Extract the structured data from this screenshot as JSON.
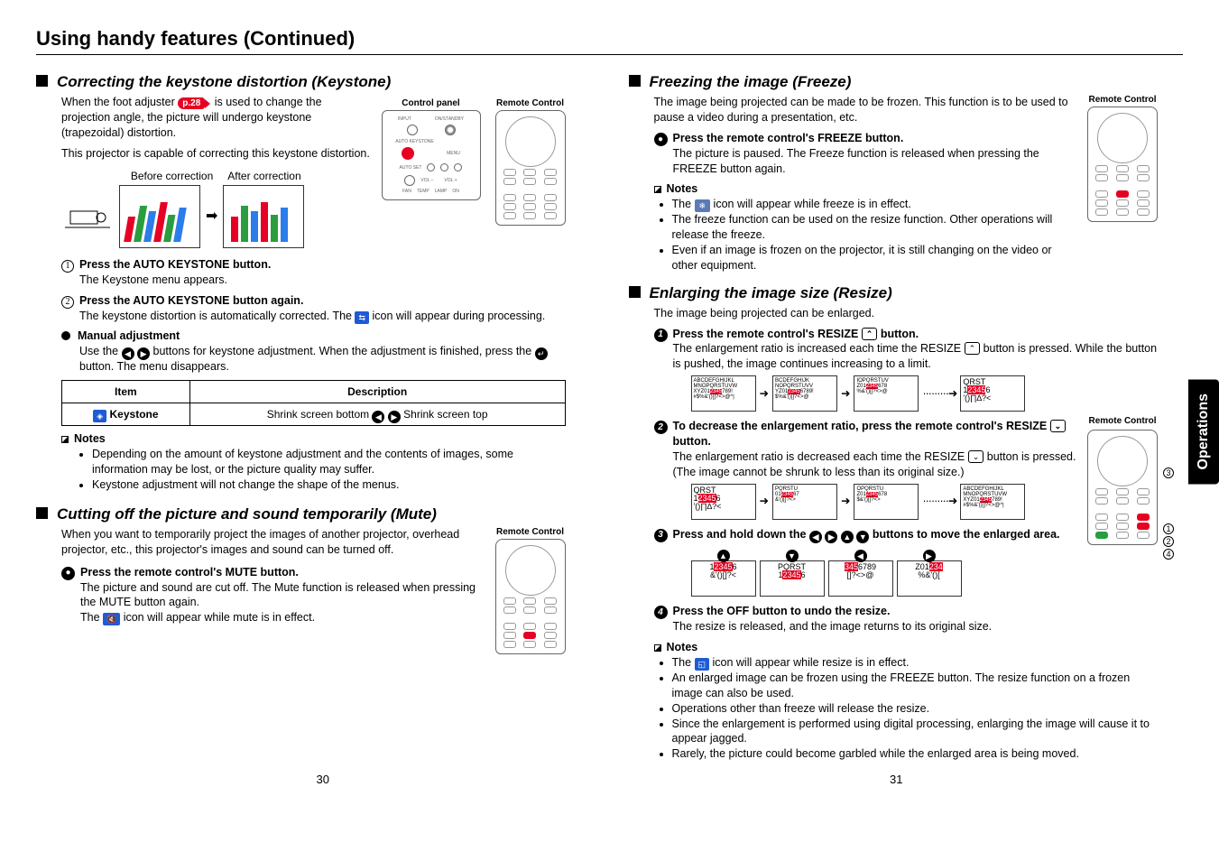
{
  "page_title": "Using handy features (Continued)",
  "left": {
    "keystone": {
      "heading": "Correcting the keystone distortion (Keystone)",
      "intro1a": "When the foot adjuster ",
      "p28": "p.28",
      "intro1b": " is used to change the projection angle, the picture will undergo keystone (trapezoidal) distortion.",
      "intro2": "This projector is capable of correcting this keystone distortion.",
      "before": "Before correction",
      "after": "After correction",
      "cp_label": "Control panel",
      "rc_label": "Remote Control",
      "step1": "Press the AUTO KEYSTONE button.",
      "step1_body": "The Keystone menu appears.",
      "step2": "Press the AUTO KEYSTONE button again.",
      "step2_body_a": "The keystone distortion is automatically corrected. The ",
      "step2_body_b": " icon will appear during processing.",
      "manual_head": "Manual adjustment",
      "manual_body_a": "Use the ",
      "manual_body_b": " buttons for keystone adjustment. When the adjustment is finished, press the ",
      "manual_body_c": " button. The menu disappears.",
      "table": {
        "h1": "Item",
        "h2": "Description",
        "r1c1": "Keystone",
        "r1c2a": "Shrink screen bottom ",
        "r1c2b": " Shrink screen top"
      },
      "notes_head": "Notes",
      "note1": "Depending on the amount of keystone adjustment and the contents of images, some information may be lost, or the picture quality may suffer.",
      "note2": "Keystone adjustment will not change the shape of the menus."
    },
    "mute": {
      "heading": "Cutting off the picture and sound temporarily (Mute)",
      "intro": "When you want to temporarily project the images of another projector, overhead projector, etc., this projector's images and sound can be turned off.",
      "rc_label": "Remote Control",
      "step": "Press the remote control's MUTE button.",
      "step_body_a": "The picture and sound are cut off. The Mute function is released when pressing the MUTE button again.",
      "step_body_b": "The ",
      "step_body_c": " icon will appear while mute is in effect."
    },
    "page_no": "30"
  },
  "right": {
    "freeze": {
      "heading": "Freezing the image (Freeze)",
      "intro": "The image being projected can be made to be frozen. This function is to be used to pause a video during a presentation, etc.",
      "rc_label": "Remote Control",
      "step": "Press the remote control's FREEZE button.",
      "step_body": "The picture is paused. The Freeze function is released when pressing the FREEZE button again.",
      "notes_head": "Notes",
      "note1a": "The ",
      "note1b": " icon will appear while freeze is in effect.",
      "note2": "The freeze function can be used on the resize function. Other operations will release the freeze.",
      "note3": "Even if an image is frozen on the projector, it is still changing on the video or other equipment."
    },
    "resize": {
      "heading": "Enlarging the image size (Resize)",
      "intro": "The image being projected can be enlarged.",
      "s1a": "Press the remote control's RESIZE ",
      "s1b": " button.",
      "s1body_a": "The enlargement ratio is increased each time the RESIZE ",
      "s1body_b": " button is pressed. While the button is pushed, the image continues increasing to a limit.",
      "s2a": "To decrease the enlargement ratio, press the remote control's RESIZE ",
      "s2b": " button.",
      "s2body_a": "The enlargement ratio is decreased each time the RESIZE ",
      "s2body_b": " button is pressed. (The image cannot be shrunk to less than its original size.)",
      "rc_label": "Remote Control",
      "s3a": "Press and hold down the ",
      "s3b": " buttons to move the enlarged area.",
      "s4": "Press the OFF button to undo the resize.",
      "s4body": "The resize is released, and the image returns to its original size.",
      "notes_head": "Notes",
      "n1a": "The ",
      "n1b": " icon will appear while resize is in effect.",
      "n2": "An enlarged image can be frozen using the FREEZE button. The resize function on a frozen image can also be used.",
      "n3": "Operations other than freeze will release the resize.",
      "n4": "Since the enlargement is performed using digital processing, enlarging the image will cause it to appear jagged.",
      "n5": "Rarely, the picture could become garbled while the enlarged area is being moved."
    },
    "page_no": "31"
  },
  "ops_tab": "Operations",
  "cp_labels": {
    "input": "INPUT",
    "onstandby": "ON/STANDBY",
    "auto": "AUTO KEYSTONE",
    "menu": "MENU",
    "autoset": "AUTO SET",
    "volm": "VOL –",
    "volp": "VOL +",
    "fan": "FAN",
    "temp": "TEMP",
    "lamp": "LAMP",
    "on": "ON"
  }
}
